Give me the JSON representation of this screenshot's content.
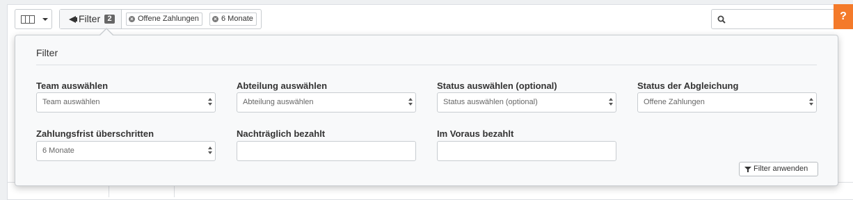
{
  "toolbar": {
    "columns_icon": "columns-icon",
    "filter_label": "Filter",
    "filter_count": "2",
    "active_filters": [
      {
        "label": "Offene Zahlungen",
        "remove_icon": "remove-circle-icon"
      },
      {
        "label": "6 Monate",
        "remove_icon": "remove-circle-icon"
      }
    ],
    "search_icon": "search-icon",
    "search_value": "",
    "help_label": "?"
  },
  "filter_panel": {
    "title": "Filter",
    "fields": [
      {
        "label": "Team auswählen",
        "type": "select",
        "value": "Team auswählen"
      },
      {
        "label": "Abteilung auswählen",
        "type": "select",
        "value": "Abteilung auswählen"
      },
      {
        "label": "Status auswählen (optional)",
        "type": "select",
        "value": "Status auswählen (optional)"
      },
      {
        "label": "Status der Abgleichung",
        "type": "select",
        "value": "Offene Zahlungen"
      },
      {
        "label": "Zahlungsfrist überschritten",
        "type": "select",
        "value": "6 Monate"
      },
      {
        "label": "Nachträglich bezahlt",
        "type": "text",
        "value": ""
      },
      {
        "label": "Im Voraus bezahlt",
        "type": "text",
        "value": ""
      }
    ],
    "apply_label": "Filter anwenden"
  },
  "colors": {
    "help_accent": "#f47a2a",
    "badge": "#666666",
    "panel_background": "#f8f9fa"
  }
}
